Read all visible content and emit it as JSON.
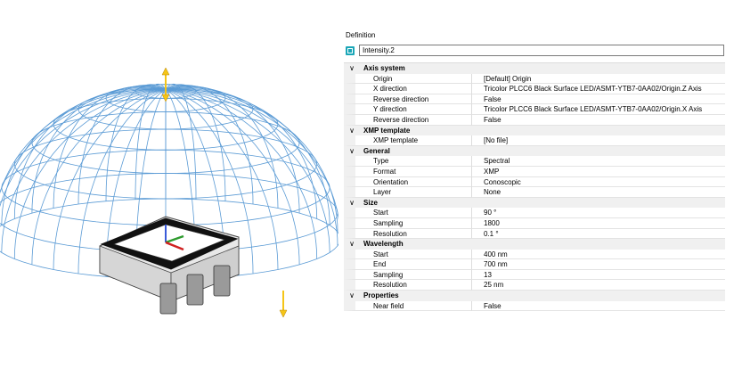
{
  "panel": {
    "title": "Definition",
    "name_value": "Intensity.2",
    "categories": [
      {
        "label": "Axis system",
        "rows": [
          {
            "name": "Origin",
            "value": "[Default] Origin"
          },
          {
            "name": "X direction",
            "value": "Tricolor PLCC6 Black Surface LED/ASMT-YTB7-0AA02/Origin.Z Axis"
          },
          {
            "name": "Reverse direction",
            "value": "False"
          },
          {
            "name": "Y direction",
            "value": "Tricolor PLCC6 Black Surface LED/ASMT-YTB7-0AA02/Origin.X Axis"
          },
          {
            "name": "Reverse direction",
            "value": "False"
          }
        ]
      },
      {
        "label": "XMP template",
        "rows": [
          {
            "name": "XMP template",
            "value": "[No file]"
          }
        ]
      },
      {
        "label": "General",
        "rows": [
          {
            "name": "Type",
            "value": "Spectral"
          },
          {
            "name": "Format",
            "value": "XMP"
          },
          {
            "name": "Orientation",
            "value": "Conoscopic"
          },
          {
            "name": "Layer",
            "value": "None"
          }
        ]
      },
      {
        "label": "Size",
        "rows": [
          {
            "name": "Start",
            "value": "90 °"
          },
          {
            "name": "Sampling",
            "value": "1800"
          },
          {
            "name": "Resolution",
            "value": "0.1 °"
          }
        ]
      },
      {
        "label": "Wavelength",
        "rows": [
          {
            "name": "Start",
            "value": "400 nm"
          },
          {
            "name": "End",
            "value": "700 nm"
          },
          {
            "name": "Sampling",
            "value": "13"
          },
          {
            "name": "Resolution",
            "value": "25 nm"
          }
        ]
      },
      {
        "label": "Properties",
        "rows": [
          {
            "name": "Near field",
            "value": "False"
          }
        ]
      }
    ]
  },
  "icons": {
    "collapse": "chevron-down-icon",
    "definition": "intensity-sensor-icon"
  },
  "colors": {
    "wireframe": "#5b9bd5",
    "arrow": "#f5c518",
    "category_bg": "#f0f0f0"
  }
}
